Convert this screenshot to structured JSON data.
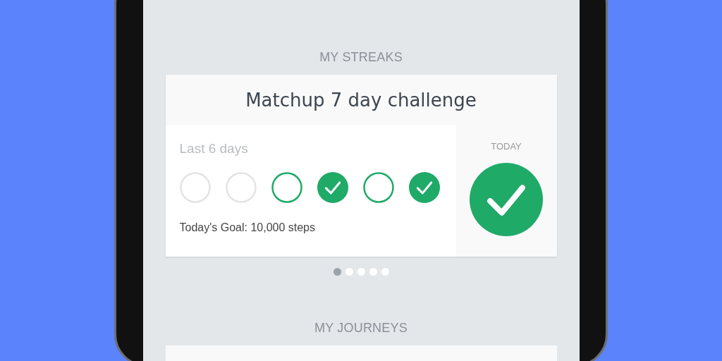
{
  "streaks": {
    "heading": "MY STREAKS",
    "card": {
      "title": "Matchup 7 day challenge",
      "history_label": "Last 6 days",
      "days": [
        {
          "kind": "missed"
        },
        {
          "kind": "missed"
        },
        {
          "kind": "open"
        },
        {
          "kind": "done"
        },
        {
          "kind": "open"
        },
        {
          "kind": "done"
        }
      ],
      "goal": "Today's Goal: 10,000 steps",
      "today_label": "TODAY",
      "today_done": true
    },
    "pager": [
      {
        "selected": true
      },
      {
        "selected": false
      },
      {
        "selected": false
      },
      {
        "selected": false
      },
      {
        "selected": false
      }
    ]
  },
  "journeys": {
    "heading": "MY JOURNEYS"
  }
}
